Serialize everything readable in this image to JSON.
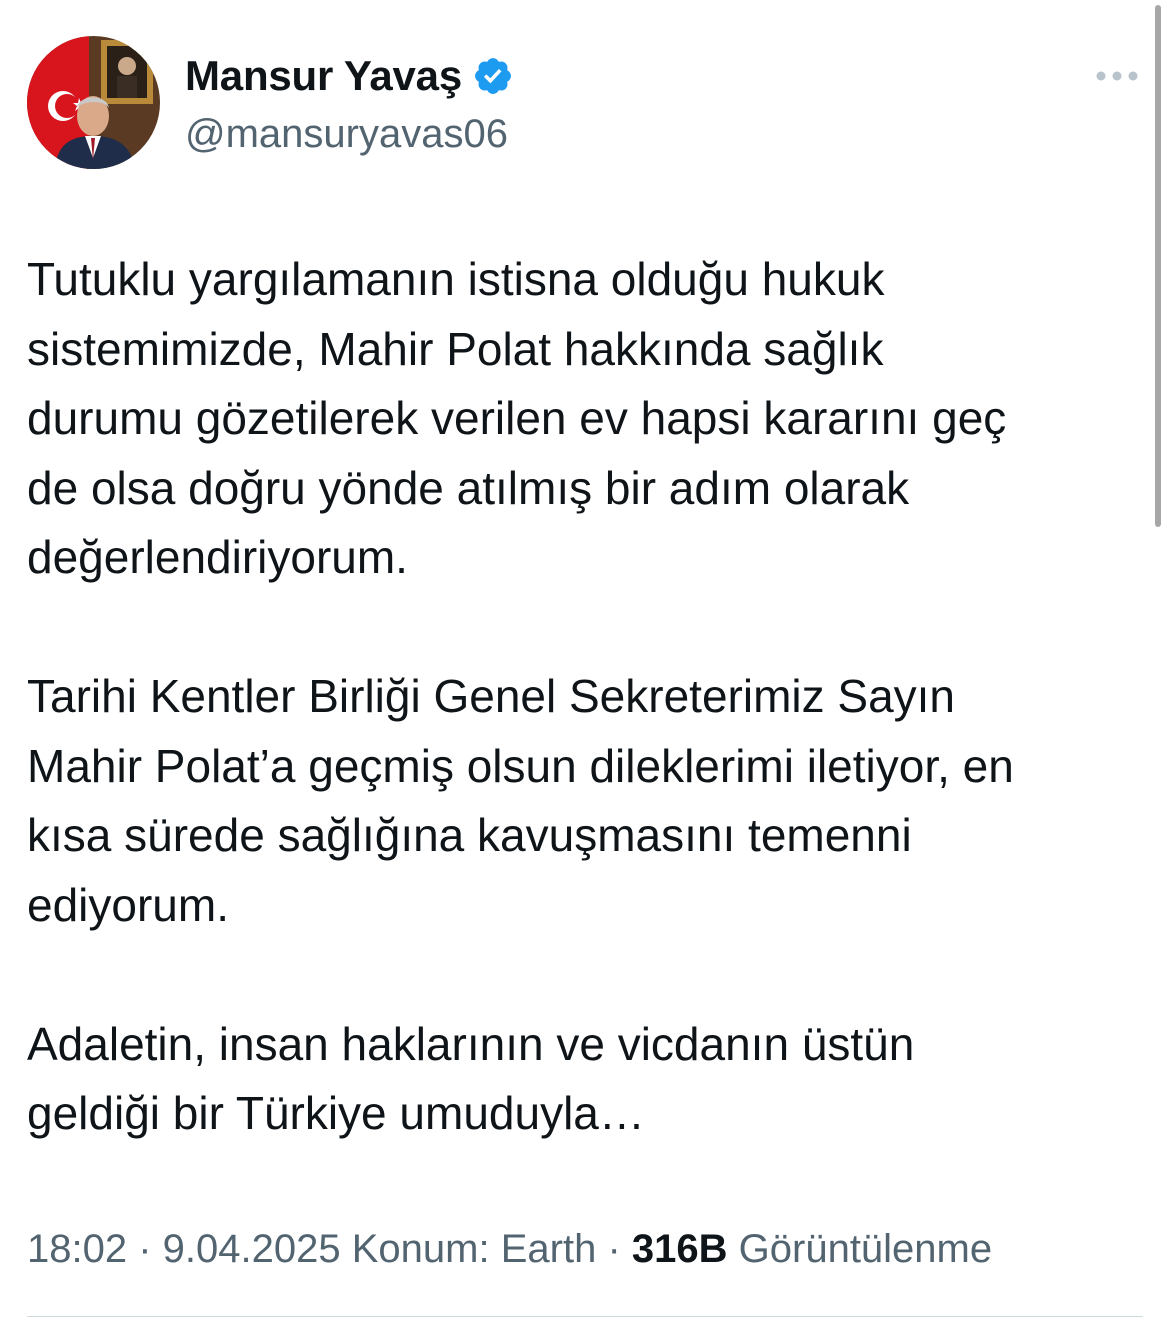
{
  "author": {
    "display_name": "Mansur Yavaş",
    "handle": "@mansuryavas06",
    "verified": true,
    "avatar_icon": "profile-photo"
  },
  "tweet": {
    "text": "Tutuklu yargılamanın istisna olduğu hukuk\nsistemimizde, Mahir Polat hakkında sağlık\ndurumu gözetilerek verilen ev hapsi kararını geç\nde olsa doğru yönde atılmış bir adım olarak\ndeğerlendiriyorum.\n\nTarihi Kentler Birliği Genel Sekreterimiz Sayın\nMahir Polat’a geçmiş olsun dileklerimi iletiyor, en\nkısa sürede sağlığına kavuşmasını temenni\nediyorum.\n\nAdaletin, insan haklarının ve vicdanın üstün\ngeldiği bir Türkiye umuduyla…",
    "time": "18:02",
    "date": "9.04.2025",
    "location_label": "Konum: Earth",
    "views_count": "316B",
    "views_label": "Görüntülenme"
  },
  "colors": {
    "text_primary": "#0f1419",
    "text_secondary": "#536471",
    "verified_badge": "#1d9bf0",
    "divider": "#cfd9de",
    "more_icon": "#b9c3cb"
  },
  "icons": {
    "verified": "verified-badge-icon",
    "more": "more-options-icon"
  }
}
